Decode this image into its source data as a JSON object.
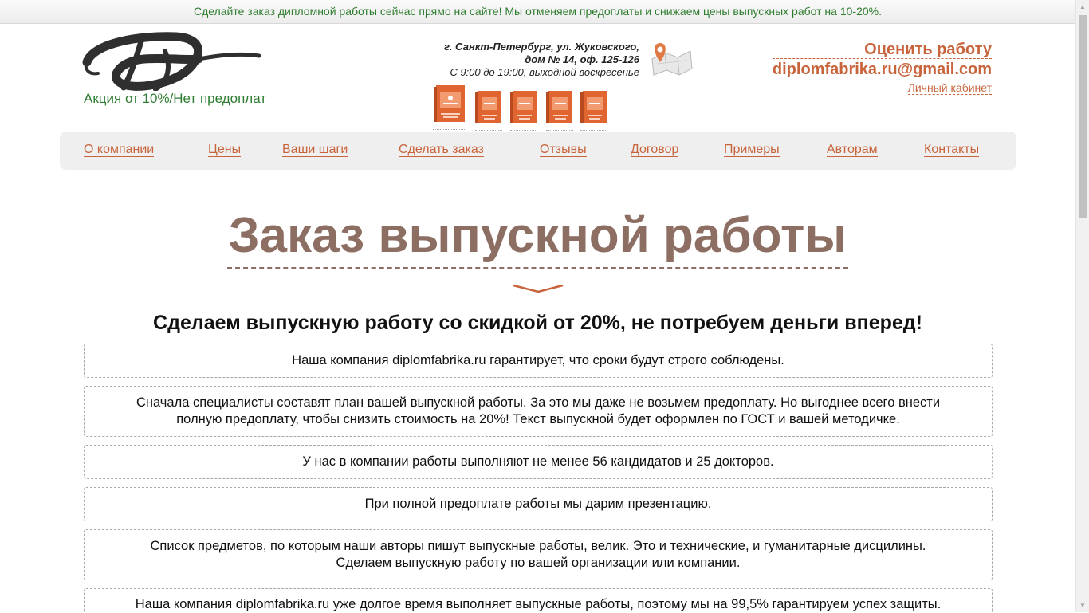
{
  "promo": {
    "text": "Сделайте заказ дипломной работы сейчас прямо на сайте! Мы отменяем предоплаты и снижаем цены выпускных работ на 10-20%."
  },
  "logo": {
    "tagline": "Акция от 10%/Нет предоплат"
  },
  "contact": {
    "address_line1": "г. Санкт-Петербург, ул. Жуковского,",
    "address_line2": "дом № 14, оф. 125-126",
    "hours": "С 9:00 до 19:00, выходной воскресенье",
    "estimate_link": "Оценить работу",
    "email": "diplomfabrika.ru@gmail.com",
    "cabinet_link": "Личный кабинет"
  },
  "nav": [
    "О компании",
    "Цены",
    "Ваши шаги",
    "Сделать заказ",
    "Отзывы",
    "Договор",
    "Примеры",
    "Авторам",
    "Контакты"
  ],
  "page": {
    "title": "Заказ выпускной работы",
    "subtitle": "Сделаем выпускную работу со скидкой от 20%, не потребуем деньги вперед!"
  },
  "features": [
    {
      "line1": "Наша компания diplomfabrika.ru гарантирует, что сроки будут строго соблюдены."
    },
    {
      "line1": "Сначала специалисты составят план вашей выпускной работы. За это мы даже не возьмем предоплату. Но выгоднее всего внести",
      "line2": "полную предоплату, чтобы снизить стоимость на 20%! Текст выпускной будет оформлен по ГОСТ и вашей методичке."
    },
    {
      "line1": "У нас в компании работы выполняют не менее 56 кандидатов и 25 докторов."
    },
    {
      "line1": "При полной предоплате работы мы дарим презентацию."
    },
    {
      "line1": "Список предметов, по которым наши авторы пишут выпускные работы, велик. Это и технические, и гуманитарные дисцилины.",
      "line2": "Сделаем выпускную работу по вашей организации или компании."
    },
    {
      "line1": "Наша компания diplomfabrika.ru уже долгое время выполняет выпускные работы, поэтому мы на 99,5% гарантируем успех защиты."
    }
  ],
  "colors": {
    "accent": "#c8643c",
    "green": "#2e7d32",
    "title": "#8d6e63",
    "nav_bg": "#efefef"
  }
}
